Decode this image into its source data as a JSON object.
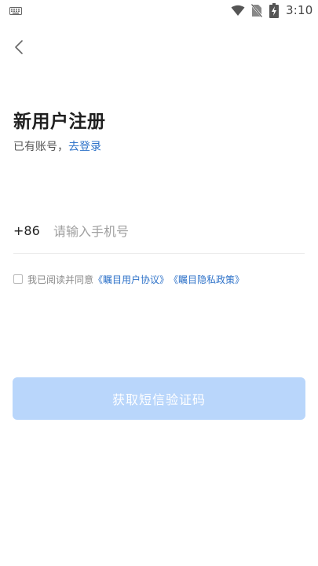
{
  "status_bar": {
    "time": "3:10",
    "icons": [
      "keyboard-icon",
      "wifi-icon",
      "no-sim-icon",
      "battery-charging-icon"
    ]
  },
  "nav": {
    "back_icon": "chevron-left-icon"
  },
  "register": {
    "title": "新用户注册",
    "has_account_text": "已有账号，",
    "login_link": "去登录"
  },
  "phone": {
    "country_code": "+86",
    "placeholder": "请输入手机号",
    "value": ""
  },
  "agreement": {
    "checked": false,
    "prefix": "我已阅读并同意",
    "user_agreement": "《瞩目用户协议》",
    "privacy_policy": "《瞩目隐私政策》"
  },
  "actions": {
    "get_code_label": "获取短信验证码",
    "button_color": "#b9d6fb"
  },
  "colors": {
    "link": "#2f73c9",
    "title": "#1f1f1f",
    "muted": "#8a8a8a"
  }
}
